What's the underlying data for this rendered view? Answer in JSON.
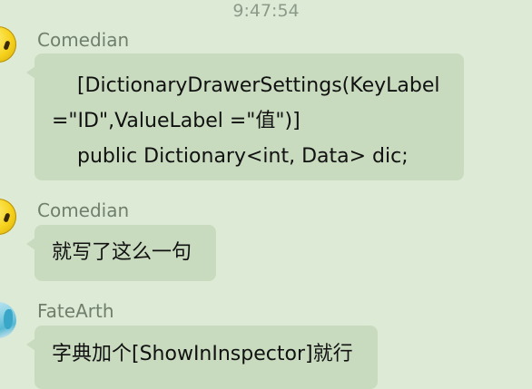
{
  "timestamp": "9:47:54",
  "messages": [
    {
      "sender": "Comedian",
      "avatar": "yellow-emoji-face-icon",
      "lines": [
        "    [DictionaryDrawerSettings(KeyLabel",
        "=\"ID\",ValueLabel =\"值\")]",
        "    public Dictionary<int, Data> dic;"
      ]
    },
    {
      "sender": "Comedian",
      "avatar": "yellow-emoji-face-icon",
      "lines": [
        "就写了这么一句"
      ]
    },
    {
      "sender": "FateArth",
      "avatar": "anime-character-avatar-icon",
      "lines": [
        "字典加个[ShowInInspector]就行"
      ]
    }
  ],
  "colors": {
    "background": "#ddebd6",
    "bubble": "#c9dbbf",
    "sender_text": "#6f7f6c",
    "timestamp_text": "#8c9a8a"
  }
}
